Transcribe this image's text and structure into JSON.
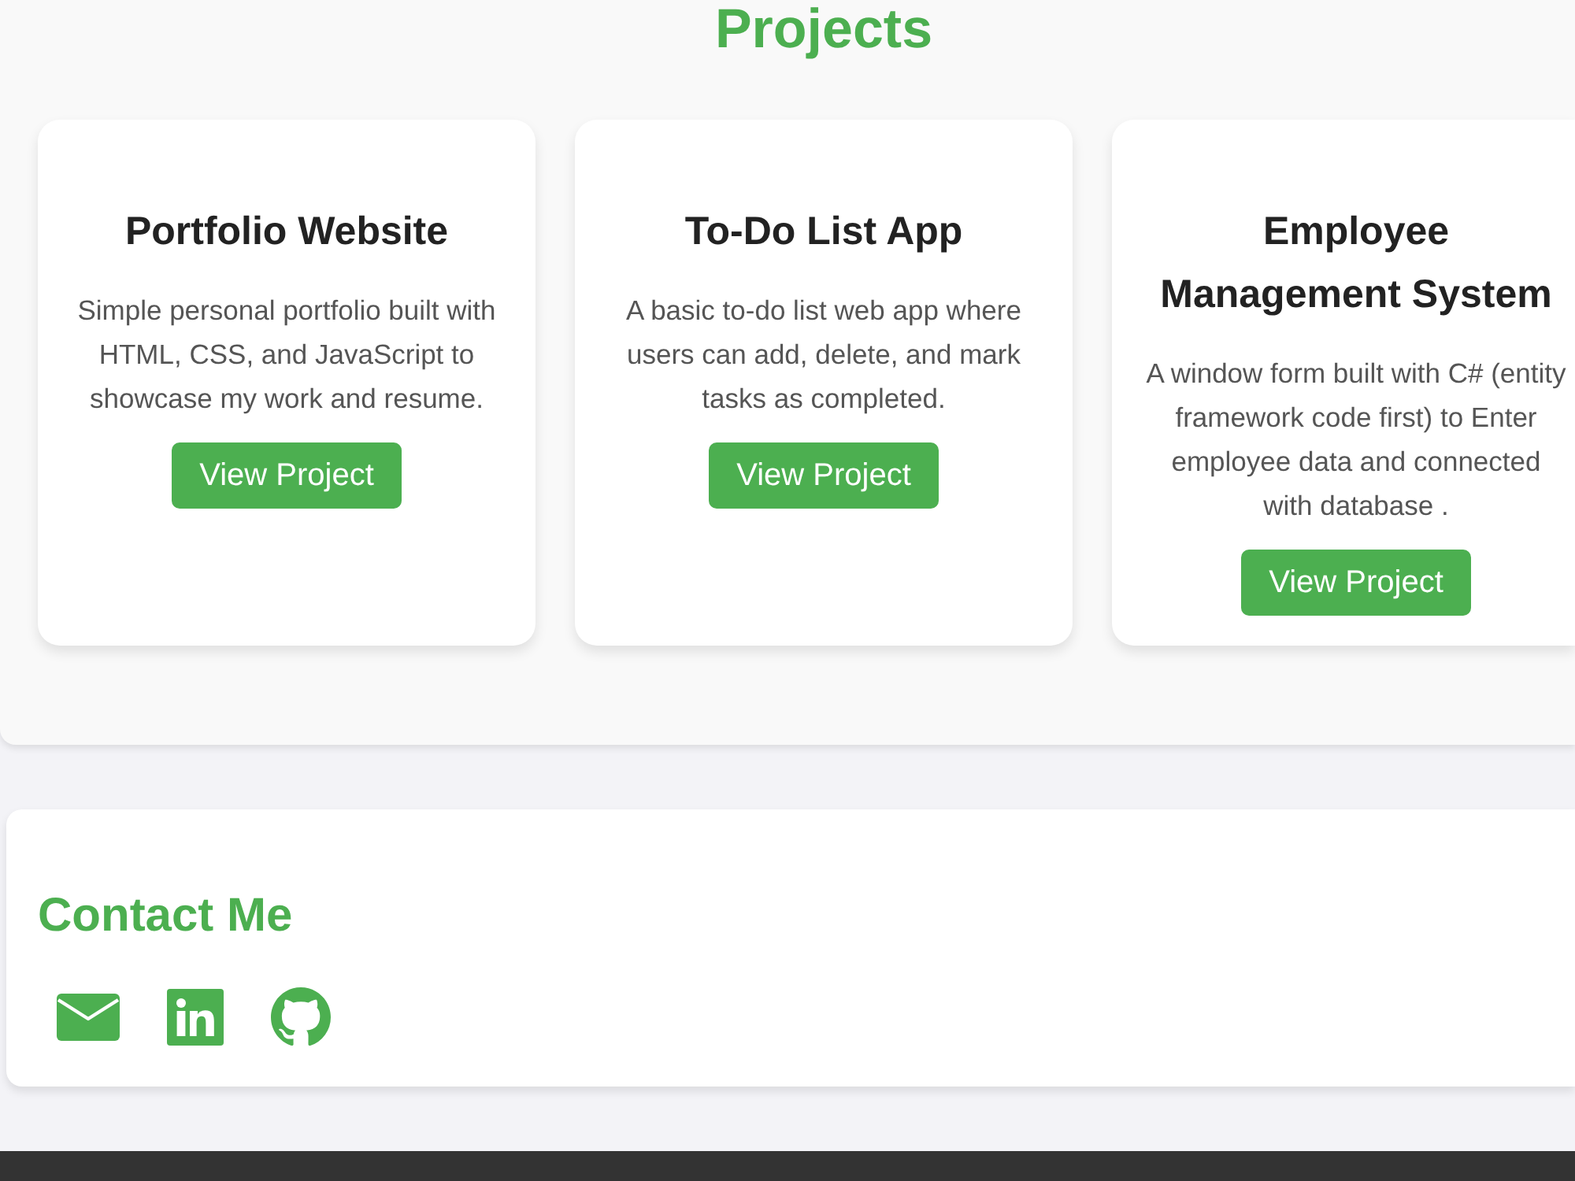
{
  "projects": {
    "heading": "Projects",
    "cards": [
      {
        "title": "Portfolio Website",
        "description": "Simple personal portfolio built with HTML, CSS, and JavaScript to showcase my work and resume.",
        "button": "View Project"
      },
      {
        "title": "To-Do List App",
        "description": "A basic to-do list web app where users can add, delete, and mark tasks as completed.",
        "button": "View Project"
      },
      {
        "title": "Employee Management System",
        "description": "A window form built with C# (entity framework code first) to Enter employee data and connected with database .",
        "button": "View Project"
      }
    ]
  },
  "contact": {
    "heading": "Contact Me",
    "links": [
      {
        "kind": "email"
      },
      {
        "kind": "linkedin"
      },
      {
        "kind": "github"
      }
    ]
  }
}
